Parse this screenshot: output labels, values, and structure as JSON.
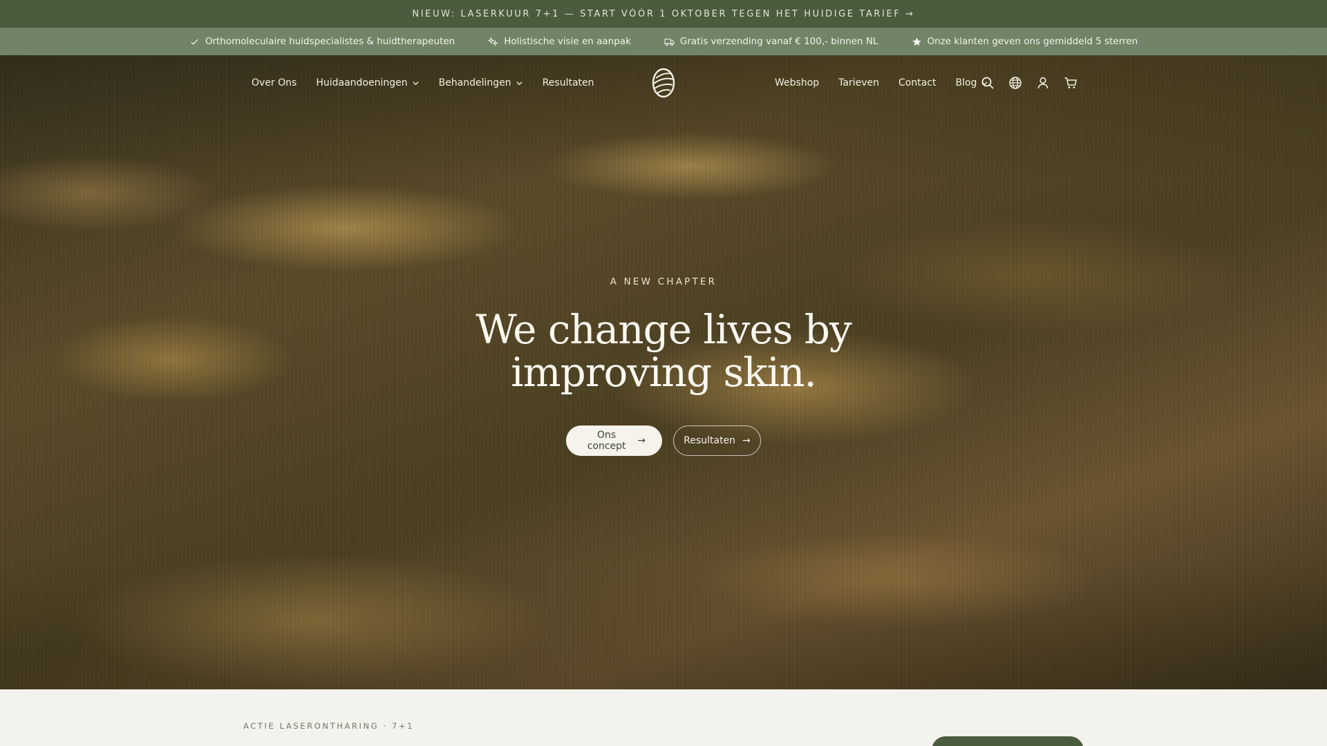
{
  "announcement": {
    "text": "NIEUW: LASERKUUR 7+1 — START VÓÓR 1 OKTOBER TEGEN HET HUIDIGE TARIEF →"
  },
  "usp": [
    {
      "icon": "check-icon",
      "text": "Orthomoleculaire huidspecialistes & huidtherapeuten"
    },
    {
      "icon": "sparkle-icon",
      "text": "Holistische visie en aanpak"
    },
    {
      "icon": "truck-icon",
      "text": "Gratis verzending vanaf € 100,- binnen NL"
    },
    {
      "icon": "star-icon",
      "text": "Onze klanten geven ons gemiddeld 5 sterren"
    }
  ],
  "nav": {
    "left": [
      {
        "label": "Over Ons",
        "dropdown": false
      },
      {
        "label": "Huidaandoeningen",
        "dropdown": true
      },
      {
        "label": "Behandelingen",
        "dropdown": true
      },
      {
        "label": "Resultaten",
        "dropdown": false
      }
    ],
    "right": [
      {
        "label": "Webshop",
        "dropdown": false
      },
      {
        "label": "Tarieven",
        "dropdown": false
      },
      {
        "label": "Contact",
        "dropdown": false
      },
      {
        "label": "Blog",
        "dropdown": true
      }
    ],
    "icons": [
      "search-icon",
      "globe-icon",
      "account-icon",
      "cart-icon"
    ]
  },
  "hero": {
    "eyebrow": "A NEW CHAPTER",
    "headline": "We change lives by improving skin.",
    "primary_cta": "Ons concept",
    "secondary_cta": "Resultaten",
    "arrow": "→"
  },
  "promo": {
    "eyebrow": "ACTIE LASERONTHARING · 7+1"
  },
  "colors": {
    "announce_bg": "#4a5b3e",
    "usp_bg": "#718467",
    "page_bg": "#f3f2ec"
  }
}
